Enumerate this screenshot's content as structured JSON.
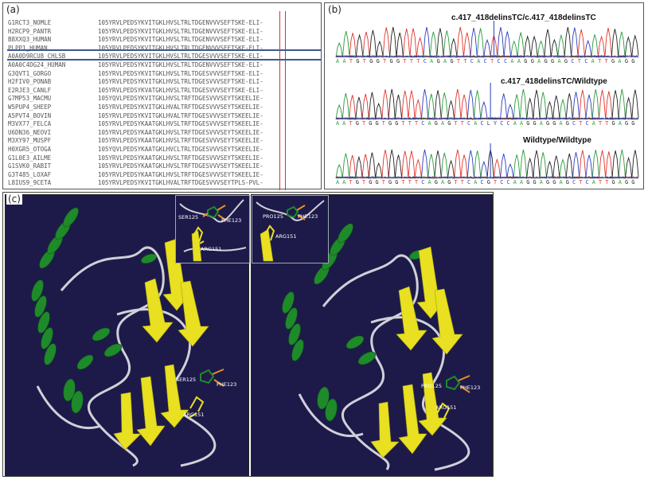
{
  "panels": {
    "a": {
      "label": "(a)",
      "pos_prefix": "10",
      "rows": [
        {
          "id": "G1RCT3_NOMLE",
          "seq": "5YRVLPEDSYKVITGKLHVSLTRLTDGENVVVSEFTSKE-ELI-"
        },
        {
          "id": "H2RCP9_PANTR",
          "seq": "5YRVLPEDSYKVITGKLHVSLTRLTDGENVVVSEFTSKE-ELI-"
        },
        {
          "id": "B8XXQ3_HUMAN",
          "seq": "5YRVLPEDSYKVITGKLHVSLTRLTDGENVVVSEFTSKE-ELI-"
        },
        {
          "id": "PLPP1_HUMAN",
          "seq": "5YRVLPEDSYKVITGKLHVSLTRLTDGENVVVSEFTSKE-ELI-"
        },
        {
          "id": "A0A0D9RCU8_CHLSB",
          "seq": "5YRVLPEDSYKVITGKLHVSLTRLTDGESVVVSEFTSKE-ELI-"
        },
        {
          "id": "A0A0C4DG24_HUMAN",
          "seq": "5YRVLPEDSYKVITGKLHVSLTRLTDGENVVVSEFTSKE-ELI-"
        },
        {
          "id": "G3QVT1_GORGO",
          "seq": "5YRVLPEDSYKVITGKLHVSLTRLTDGESVVVSEFTSKE-ELI-"
        },
        {
          "id": "H2FIV0_PONAB",
          "seq": "5YRVLPEDSYKVITGKLHVSLTRLTDGESVVVSEFTSKE-ELI-"
        },
        {
          "id": "E2RJE3_CANLF",
          "seq": "5YRVLPEDSYKVATGKLHVSLTRLTDGESVVVSEYTSKE-ELI-"
        },
        {
          "id": "G7MP53_MACMU",
          "seq": "5YQVLPEDSYKVITGKLHVSLTRFTDGESVVVSEYTSKEELIE-"
        },
        {
          "id": "W5PUP4_SHEEP",
          "seq": "5YRVLPEDSYKVITGKLHVALTRFTDGESVVVSEYTSKEELIE-"
        },
        {
          "id": "A5PVT4_BOVIN",
          "seq": "5YRVLPEDSYKVITGKLHVALTRFTDGESVVVSEYTSKEELIE-"
        },
        {
          "id": "M3VX77_FELCA",
          "seq": "5YRVLPEDSYKAATGKLHVSLTRFTDGESVVVSEYTSKEELIE-"
        },
        {
          "id": "U6DN36_NEOVI",
          "seq": "5YRVLPEDSYKAATGKLHVSLTRFTDGESVVVSEYTSKEELIE-"
        },
        {
          "id": "M3XY97_MUSPF",
          "seq": "5YRVLPEDSYKAATGKLHVSLTRFTDGESVVVSEYTSKEELIE-"
        },
        {
          "id": "H0XGR5_OTOGA",
          "seq": "5YQVLPEDSYKAATGKLHVCLTRLTDGESVVVSEYTSKEELIE-"
        },
        {
          "id": "G1L0E3_AILME",
          "seq": "5YRVLPEDSYKAATGKLHVSLTRFTDGESVVVSEYTSKEELIE-"
        },
        {
          "id": "G1SVK0_RABIT",
          "seq": "5YRVLPEDSYKAATGKLHVSLTRFTDGESVVVSEYTSKEELIE-"
        },
        {
          "id": "G3T485_LOXAF",
          "seq": "5YRVLPEDSYKAATGKLHVSLTRFTDGESVVVSEYTSKEELIE-"
        },
        {
          "id": "L8IUS9_9CETA",
          "seq": "5YRVLPEDSYKVITGKLHVALTRFTDGESVVVSEYTPLS-PVL-"
        }
      ],
      "highlight_row": 3
    },
    "b": {
      "label": "(b)",
      "traces": [
        {
          "title": "c.417_418delinsTC/c.417_418delinsTC",
          "bases": "A A T G T G G T G G T T T C A G A G T T C A C T C C A A G G A G G A G C T C A T T G A G G"
        },
        {
          "title": "c.417_418delinsTC/Wildtype",
          "bases": "A A T G T G G T G G T T T C A G A G T T C A C L Y C C A A G G A G G A G C T C A T T G A G G"
        },
        {
          "title": "Wildtype/Wildtype",
          "bases": "A A T G T G G T G G T T T C A G A G T T C A C G T C C A A G G A G G A G C T C A T T G A G G"
        }
      ],
      "base_colors": {
        "A": "#2b9a3a",
        "T": "#e2342b",
        "G": "#222222",
        "C": "#2d3fbf"
      }
    },
    "c": {
      "label": "(c)",
      "left": {
        "inset_labels": {
          "ser": "SER125",
          "phe": "PHE123",
          "arg": "ARG151"
        },
        "main_labels": {
          "ser": "SER125",
          "phe": "PHE123",
          "arg": "ARG151"
        }
      },
      "right": {
        "inset_labels": {
          "pro": "PRO125",
          "phe": "PHE123",
          "arg": "ARG151"
        },
        "main_labels": {
          "pro": "PRO125",
          "phe": "PHE123",
          "arg": "ARG151"
        }
      },
      "colors": {
        "background": "#1d1a4a",
        "helix": "#1f8a2a",
        "sheet": "#e8e020",
        "coil": "#d0d0d8"
      }
    }
  }
}
